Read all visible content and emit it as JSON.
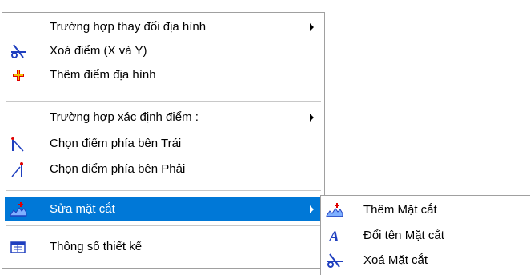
{
  "main_menu": {
    "items": [
      {
        "label": "Trường hợp thay đổi địa hình",
        "icon": null,
        "submenu": true
      },
      {
        "label": "Xoá điểm  (X và Y)",
        "icon": "scissors-icon"
      },
      {
        "label": "Thêm điểm  địa hình",
        "icon": "plus-icon"
      },
      {
        "label": "Trường hợp xác định điểm  :",
        "icon": null,
        "submenu": true
      },
      {
        "label": "Chọn điểm phía  bên Trái",
        "icon": "select-left-point-icon"
      },
      {
        "label": "Chọn điểm phía bên Phải",
        "icon": "select-right-point-icon"
      },
      {
        "label": "Sửa mặt cắt",
        "icon": "terrain-section-icon",
        "submenu": true,
        "highlighted": true
      },
      {
        "label": "Thông số thiết kế",
        "icon": "design-parameters-icon"
      }
    ]
  },
  "sub_menu": {
    "items": [
      {
        "label": "Thêm Mặt cắt",
        "icon": "terrain-section-add-icon"
      },
      {
        "label": "Đổi tên Mặt cắt",
        "icon": "rename-letter-a-icon"
      },
      {
        "label": "Xoá Mặt cắt",
        "icon": "scissors-icon"
      }
    ]
  },
  "colors": {
    "highlight": "#0078d7",
    "icon_blue": "#1f3fbf",
    "icon_red": "#e00000",
    "icon_yellow": "#f0c000"
  }
}
